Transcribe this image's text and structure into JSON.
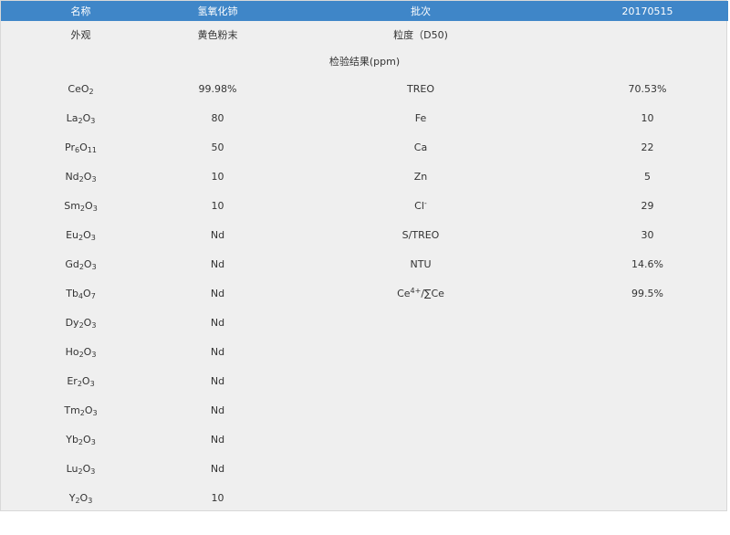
{
  "header": {
    "col1": "名称",
    "col2": "氢氧化铈",
    "col3": "批次",
    "col4": "20170515"
  },
  "subheader": {
    "col1": "外观",
    "col2": "黄色粉末",
    "col3": "粒度（D50)",
    "col4": ""
  },
  "section_title": "检验结果(ppm)",
  "rows": [
    {
      "left_base1": "CeO",
      "left_sub1": "2",
      "left_base2": "",
      "left_sub2": "",
      "left_value": "99.98%",
      "right_name": "TREO",
      "right_sup": "",
      "right_name_tail": "",
      "right_value": "70.53%"
    },
    {
      "left_base1": "La",
      "left_sub1": "2",
      "left_base2": "O",
      "left_sub2": "3",
      "left_value": "80",
      "right_name": "Fe",
      "right_sup": "",
      "right_name_tail": "",
      "right_value": "10"
    },
    {
      "left_base1": "Pr",
      "left_sub1": "6",
      "left_base2": "O",
      "left_sub2": "11",
      "left_value": "50",
      "right_name": "Ca",
      "right_sup": "",
      "right_name_tail": "",
      "right_value": "22"
    },
    {
      "left_base1": "Nd",
      "left_sub1": "2",
      "left_base2": "O",
      "left_sub2": "3",
      "left_value": "10",
      "right_name": "Zn",
      "right_sup": "",
      "right_name_tail": "",
      "right_value": "5"
    },
    {
      "left_base1": "Sm",
      "left_sub1": "2",
      "left_base2": "O",
      "left_sub2": "3",
      "left_value": "10",
      "right_name": "Cl",
      "right_sup": "-",
      "right_name_tail": "",
      "right_value": "29"
    },
    {
      "left_base1": "Eu",
      "left_sub1": "2",
      "left_base2": "O",
      "left_sub2": "3",
      "left_value": "Nd",
      "right_name": "S/TREO",
      "right_sup": "",
      "right_name_tail": "",
      "right_value": "30"
    },
    {
      "left_base1": "Gd",
      "left_sub1": "2",
      "left_base2": "O",
      "left_sub2": "3",
      "left_value": "Nd",
      "right_name": "NTU",
      "right_sup": "",
      "right_name_tail": "",
      "right_value": "14.6%"
    },
    {
      "left_base1": "Tb",
      "left_sub1": "4",
      "left_base2": "O",
      "left_sub2": "7",
      "left_value": "Nd",
      "right_name": "Ce",
      "right_sup": "4+",
      "right_name_tail": "/∑Ce",
      "right_value": "99.5%"
    },
    {
      "left_base1": "Dy",
      "left_sub1": "2",
      "left_base2": "O",
      "left_sub2": "3",
      "left_value": "Nd",
      "right_name": "",
      "right_sup": "",
      "right_name_tail": "",
      "right_value": ""
    },
    {
      "left_base1": "Ho",
      "left_sub1": "2",
      "left_base2": "O",
      "left_sub2": "3",
      "left_value": "Nd",
      "right_name": "",
      "right_sup": "",
      "right_name_tail": "",
      "right_value": ""
    },
    {
      "left_base1": "Er",
      "left_sub1": "2",
      "left_base2": "O",
      "left_sub2": "3",
      "left_value": "Nd",
      "right_name": "",
      "right_sup": "",
      "right_name_tail": "",
      "right_value": ""
    },
    {
      "left_base1": "Tm",
      "left_sub1": "2",
      "left_base2": "O",
      "left_sub2": "3",
      "left_value": "Nd",
      "right_name": "",
      "right_sup": "",
      "right_name_tail": "",
      "right_value": ""
    },
    {
      "left_base1": "Yb",
      "left_sub1": "2",
      "left_base2": "O",
      "left_sub2": "3",
      "left_value": "Nd",
      "right_name": "",
      "right_sup": "",
      "right_name_tail": "",
      "right_value": ""
    },
    {
      "left_base1": "Lu",
      "left_sub1": "2",
      "left_base2": "O",
      "left_sub2": "3",
      "left_value": "Nd",
      "right_name": "",
      "right_sup": "",
      "right_name_tail": "",
      "right_value": ""
    },
    {
      "left_base1": "Y",
      "left_sub1": "2",
      "left_base2": "O",
      "left_sub2": "3",
      "left_value": "10",
      "right_name": "",
      "right_sup": "",
      "right_name_tail": "",
      "right_value": ""
    }
  ]
}
